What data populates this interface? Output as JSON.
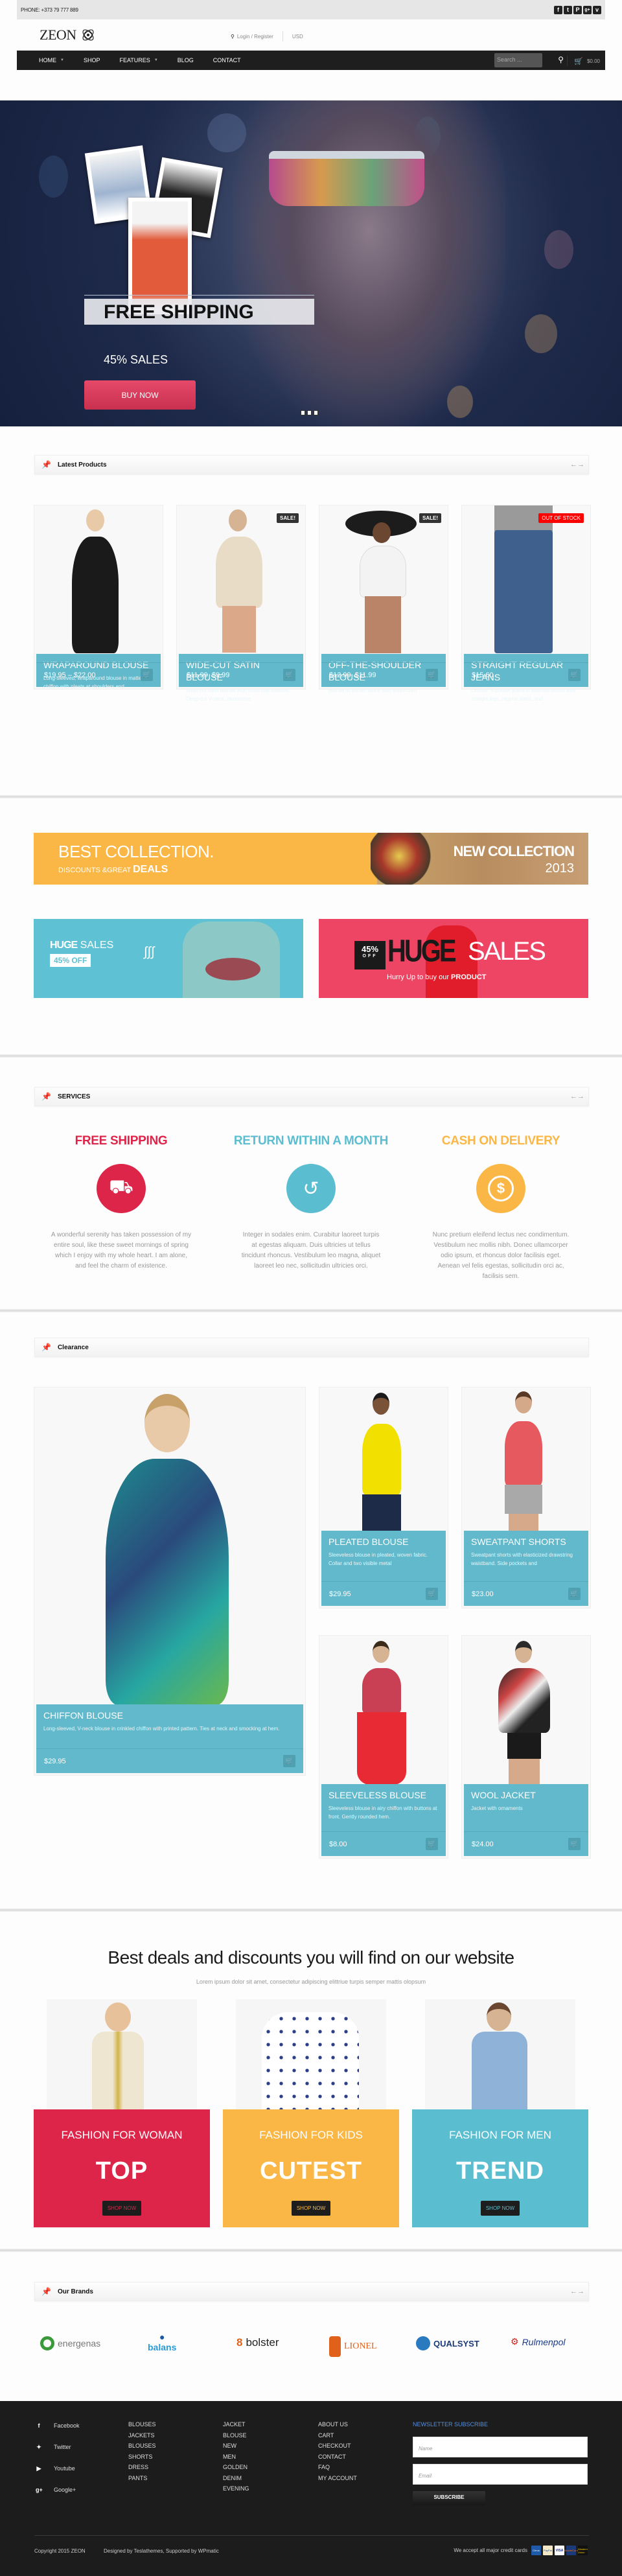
{
  "topbar": {
    "phone": "PHONE: +373 79 777 889",
    "socials": [
      {
        "icon": "facebook-icon",
        "glyph": "f"
      },
      {
        "icon": "tumblr-icon",
        "glyph": "t"
      },
      {
        "icon": "pinterest-icon",
        "glyph": "P"
      },
      {
        "icon": "google-plus-icon",
        "glyph": "g+"
      },
      {
        "icon": "vimeo-icon",
        "glyph": "v"
      }
    ]
  },
  "header": {
    "logo": "ZEON",
    "login": "Login / Register",
    "currency": "USD"
  },
  "nav": {
    "items": [
      {
        "label": "HOME",
        "dropdown": true
      },
      {
        "label": "SHOP",
        "dropdown": false
      },
      {
        "label": "FEATURES",
        "dropdown": true
      },
      {
        "label": "BLOG",
        "dropdown": false
      },
      {
        "label": "CONTACT",
        "dropdown": false
      }
    ],
    "search_placeholder": "Search ...",
    "cart_total": "$0.00"
  },
  "hero": {
    "title": "FREE SHIPPING",
    "subtitle": "45% SALES",
    "button": "BUY NOW",
    "slides": 3
  },
  "latest": {
    "title": "Latest Products",
    "products": [
      {
        "name": "WRAPAROUND BLOUSE",
        "desc": "Long-sleeved, wraparound blouse in matte chiffon with pleats at shoulders and",
        "price": "$19.95 – $22.00",
        "old_price": "",
        "badge": ""
      },
      {
        "name": "WIDE-CUT SATIN BLOUSE",
        "desc": "Wide-cut satin blouse with small cap sleeves. Deep-cut V-neck, decorative",
        "price": "$9.99",
        "old_price": "$11.99",
        "badge": "SALE!"
      },
      {
        "name": "OFF-THE-SHOULDER BLOUSE",
        "desc": "Blouse in woven fabric with elasticized",
        "price": "$11.99",
        "old_price": "$12.99",
        "badge": "SALE!"
      },
      {
        "name": "STRAIGHT REGULAR JEANS",
        "desc": "DENIM. 5-pocket jeans in washed denim with straight legs, regular waist, and",
        "price": "$15.60",
        "old_price": "",
        "badge": "OUT OF STOCK"
      }
    ]
  },
  "promos": {
    "best": {
      "line1": "BEST COLLECTION.",
      "line2a": "DISCOUNTS &GREAT ",
      "line2b": "DEALS",
      "right1": "NEW COLLECTION",
      "right2": "2013"
    },
    "huge_left": {
      "huge": "HUGE",
      "sales": " SALES",
      "off": "45% OFF"
    },
    "huge_right": {
      "pct": "45%",
      "off": "OFF",
      "huge": "HUGE",
      "sales": "SALES",
      "tag_a": "Hurry Up to buy our ",
      "tag_b": "PRODUCT"
    }
  },
  "services": {
    "title": "SERVICES",
    "items": [
      {
        "title": "FREE SHIPPING",
        "color": "#dd2549",
        "icon": "truck-icon",
        "text": "A wonderful serenity has taken possession of my entire soul, like these sweet mornings of spring which I enjoy with my whole heart. I am alone, and feel the charm of existence."
      },
      {
        "title": "RETURN WITHIN A MONTH",
        "color": "#5bbdd0",
        "icon": "history-icon",
        "text": "Integer in sodales enim. Curabitur laoreet turpis at egestas aliquam. Duis ultricies ut tellus tincidunt rhoncus. Vestibulum leo magna, aliquet laoreet leo nec, sollicitudin ultricies orci."
      },
      {
        "title": "CASH ON DELIVERY",
        "color": "#fbb745",
        "icon": "dollar-coin-icon",
        "text": "Nunc pretium eleifend lectus nec condimentum. Vestibulum nec mollis nibh. Donec ullamcorper odio ipsum, et rhoncus dolor facilisis eget. Aenean vel felis egestas, sollicitudin orci ac, facilisis sem."
      }
    ]
  },
  "clearance": {
    "title": "Clearance",
    "featured": {
      "name": "CHIFFON BLOUSE",
      "desc": "Long-sleeved, V-neck blouse in crinkled chiffon with printed pattern. Ties at neck and smocking at hem.",
      "price": "$29.95"
    },
    "products": [
      {
        "name": "PLEATED BLOUSE",
        "desc": "Sleeveless blouse in pleated, woven fabric. Collar and two visible metal",
        "price": "$29.95"
      },
      {
        "name": "SWEATPANT SHORTS",
        "desc": "Sweatpant shorts with elasticized drawstring waistband. Side pockets and",
        "price": "$23.00"
      },
      {
        "name": "SLEEVELESS BLOUSE",
        "desc": "Sleeveless blouse in airy chiffon with buttons at front. Gently rounded hem.",
        "price": "$8.00"
      },
      {
        "name": "WOOL JACKET",
        "desc": "Jacket with ornaments",
        "price": "$24.00"
      }
    ]
  },
  "deals": {
    "title": "Best deals and discounts you will find on our website",
    "subtitle": "Lorem ipsum dolor sit amet, consectetur adipiscing elittriue turpis semper mattis olopsum",
    "cards": [
      {
        "label": "FASHION FOR WOMAN",
        "big": "TOP",
        "button": "SHOP NOW",
        "color": "#dd2549"
      },
      {
        "label": "FASHION FOR KIDS",
        "big": "CUTEST",
        "button": "SHOP NOW",
        "color": "#fbb745"
      },
      {
        "label": "FASHION FOR MEN",
        "big": "TREND",
        "button": "SHOP NOW",
        "color": "#5bbdd0"
      }
    ]
  },
  "brands": {
    "title": "Our Brands",
    "items": [
      "energenas",
      "balans",
      "bolster",
      "LIONEL",
      "QUALSYST",
      "Rulmenpol"
    ]
  },
  "footer": {
    "socials": [
      "Facebook",
      "Twitter",
      "Youtube",
      "Google+"
    ],
    "col1": [
      "BLOUSES",
      "JACKETS",
      "BLOUSES",
      "SHORTS",
      "DRESS",
      "PANTS"
    ],
    "col2": [
      "JACKET",
      "BLOUSE",
      "NEW",
      "MEN",
      "GOLDEN",
      "DENIM",
      "EVENING"
    ],
    "col3": [
      "ABOUT US",
      "CART",
      "CHECKOUT",
      "CONTACT",
      "FAQ",
      "MY ACCOUNT"
    ],
    "newsletter": {
      "title": "NEWSLETTER SUBSCRIBE",
      "name_placeholder": "Name",
      "email_placeholder": "Email",
      "button": "SUBSCRIBE"
    },
    "copyright": "Copyright 2015 ZEON",
    "designed": "Designed by Teslathemes, Supported by WPmatic",
    "cards_text": "We accept all major credit cards",
    "cards": [
      "Cirrus",
      "PayPal",
      "VISA",
      "MasterCard",
      "Western Union"
    ]
  }
}
